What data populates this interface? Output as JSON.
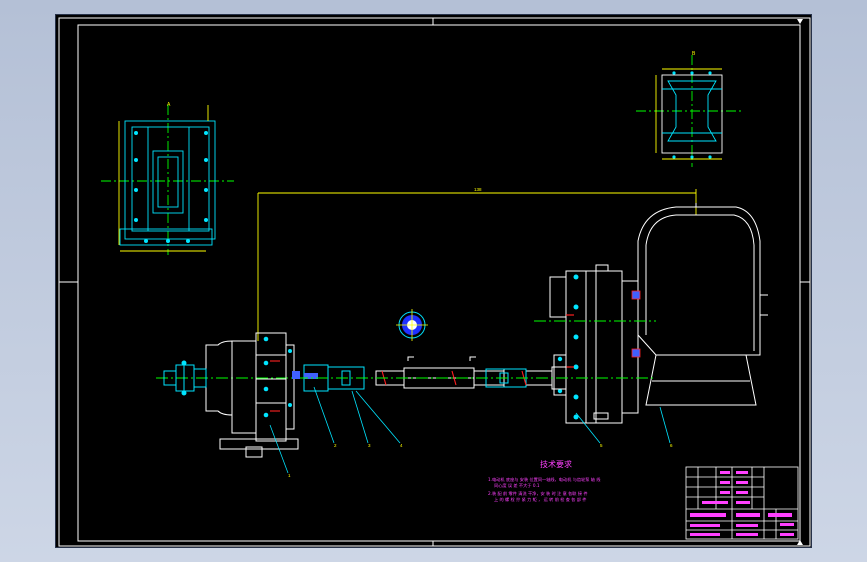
{
  "drawing": {
    "dimension_overall": "138",
    "section_label_a": "A",
    "section_label_b": "B",
    "tech_requirements": {
      "title": "技术要求",
      "line1": "1.电动机 底座与 安装 位置同一轴线，电动机 与齿轮泵 轴 线",
      "line1b": "同心度 误 差 不大于 0.1",
      "line2": "2.装 配  前 零件 清洗 干净，安 装 时 注 意 各联 接 件",
      "line2b": "上 的 螺 栓 拧 紧 力 矩 ， 运 转 前 检 查 各 部 件"
    },
    "balloons": [
      "1",
      "2",
      "3",
      "4",
      "5",
      "6",
      "7",
      "8"
    ]
  },
  "colors": {
    "background": "#000000",
    "frame": "#ffffff",
    "parts": "#00e5ff",
    "dimensions": "#ffff00",
    "centerlines": "#00ff00",
    "notes": "#ff40ff",
    "fasteners": "#4060ff",
    "highlight": "#ff2020"
  }
}
